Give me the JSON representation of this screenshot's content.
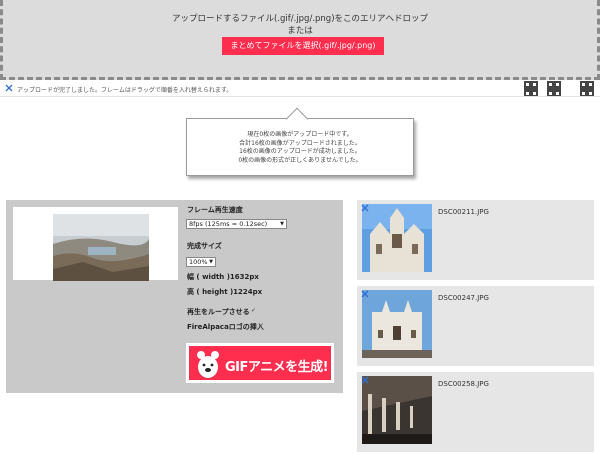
{
  "dropzone": {
    "instruction": "アップロードするファイル(.gif/.jpg/.png)をこのエリアへドロップ",
    "or": "または",
    "select_button": "まとめてファイルを選択(.gif/.jpg/.png)"
  },
  "status": {
    "message": "アップロードが完了しました。フレームはドラッグで順番を入れ替えられます。"
  },
  "bubble": {
    "lines": [
      "現在0枚の画像がアップロード中です。",
      "合計16枚の画像がアップロードされました。",
      "16枚の画像のアップロードが成功しました。",
      "0枚の画像の形式が正しくありませんでした。"
    ]
  },
  "settings": {
    "playback_speed_label": "フレーム再生速度",
    "playback_speed_value": "8fps (125ms = 0.12sec)",
    "output_size_label": "完成サイズ",
    "output_size_value": "100%",
    "width_text": "幅 ( width )1632px",
    "height_text": "高 ( height )1224px",
    "loop_label": "再生をループさせる",
    "loop_checked": true,
    "logo_label": "FireAlpacaロゴの挿入",
    "logo_checked": true,
    "generate_button": "GIFアニメを生成!"
  },
  "images": [
    {
      "filename": "DSC00211.JPG",
      "icon": "close-icon"
    },
    {
      "filename": "DSC00247.JPG",
      "icon": "close-icon"
    },
    {
      "filename": "DSC00258.JPG",
      "icon": "close-icon"
    }
  ],
  "colors": {
    "accent": "#ff2d4e",
    "dropzone_bg": "#dcdcdc",
    "panel_bg": "#c9c9c9",
    "item_bg": "#e6e6e6"
  }
}
